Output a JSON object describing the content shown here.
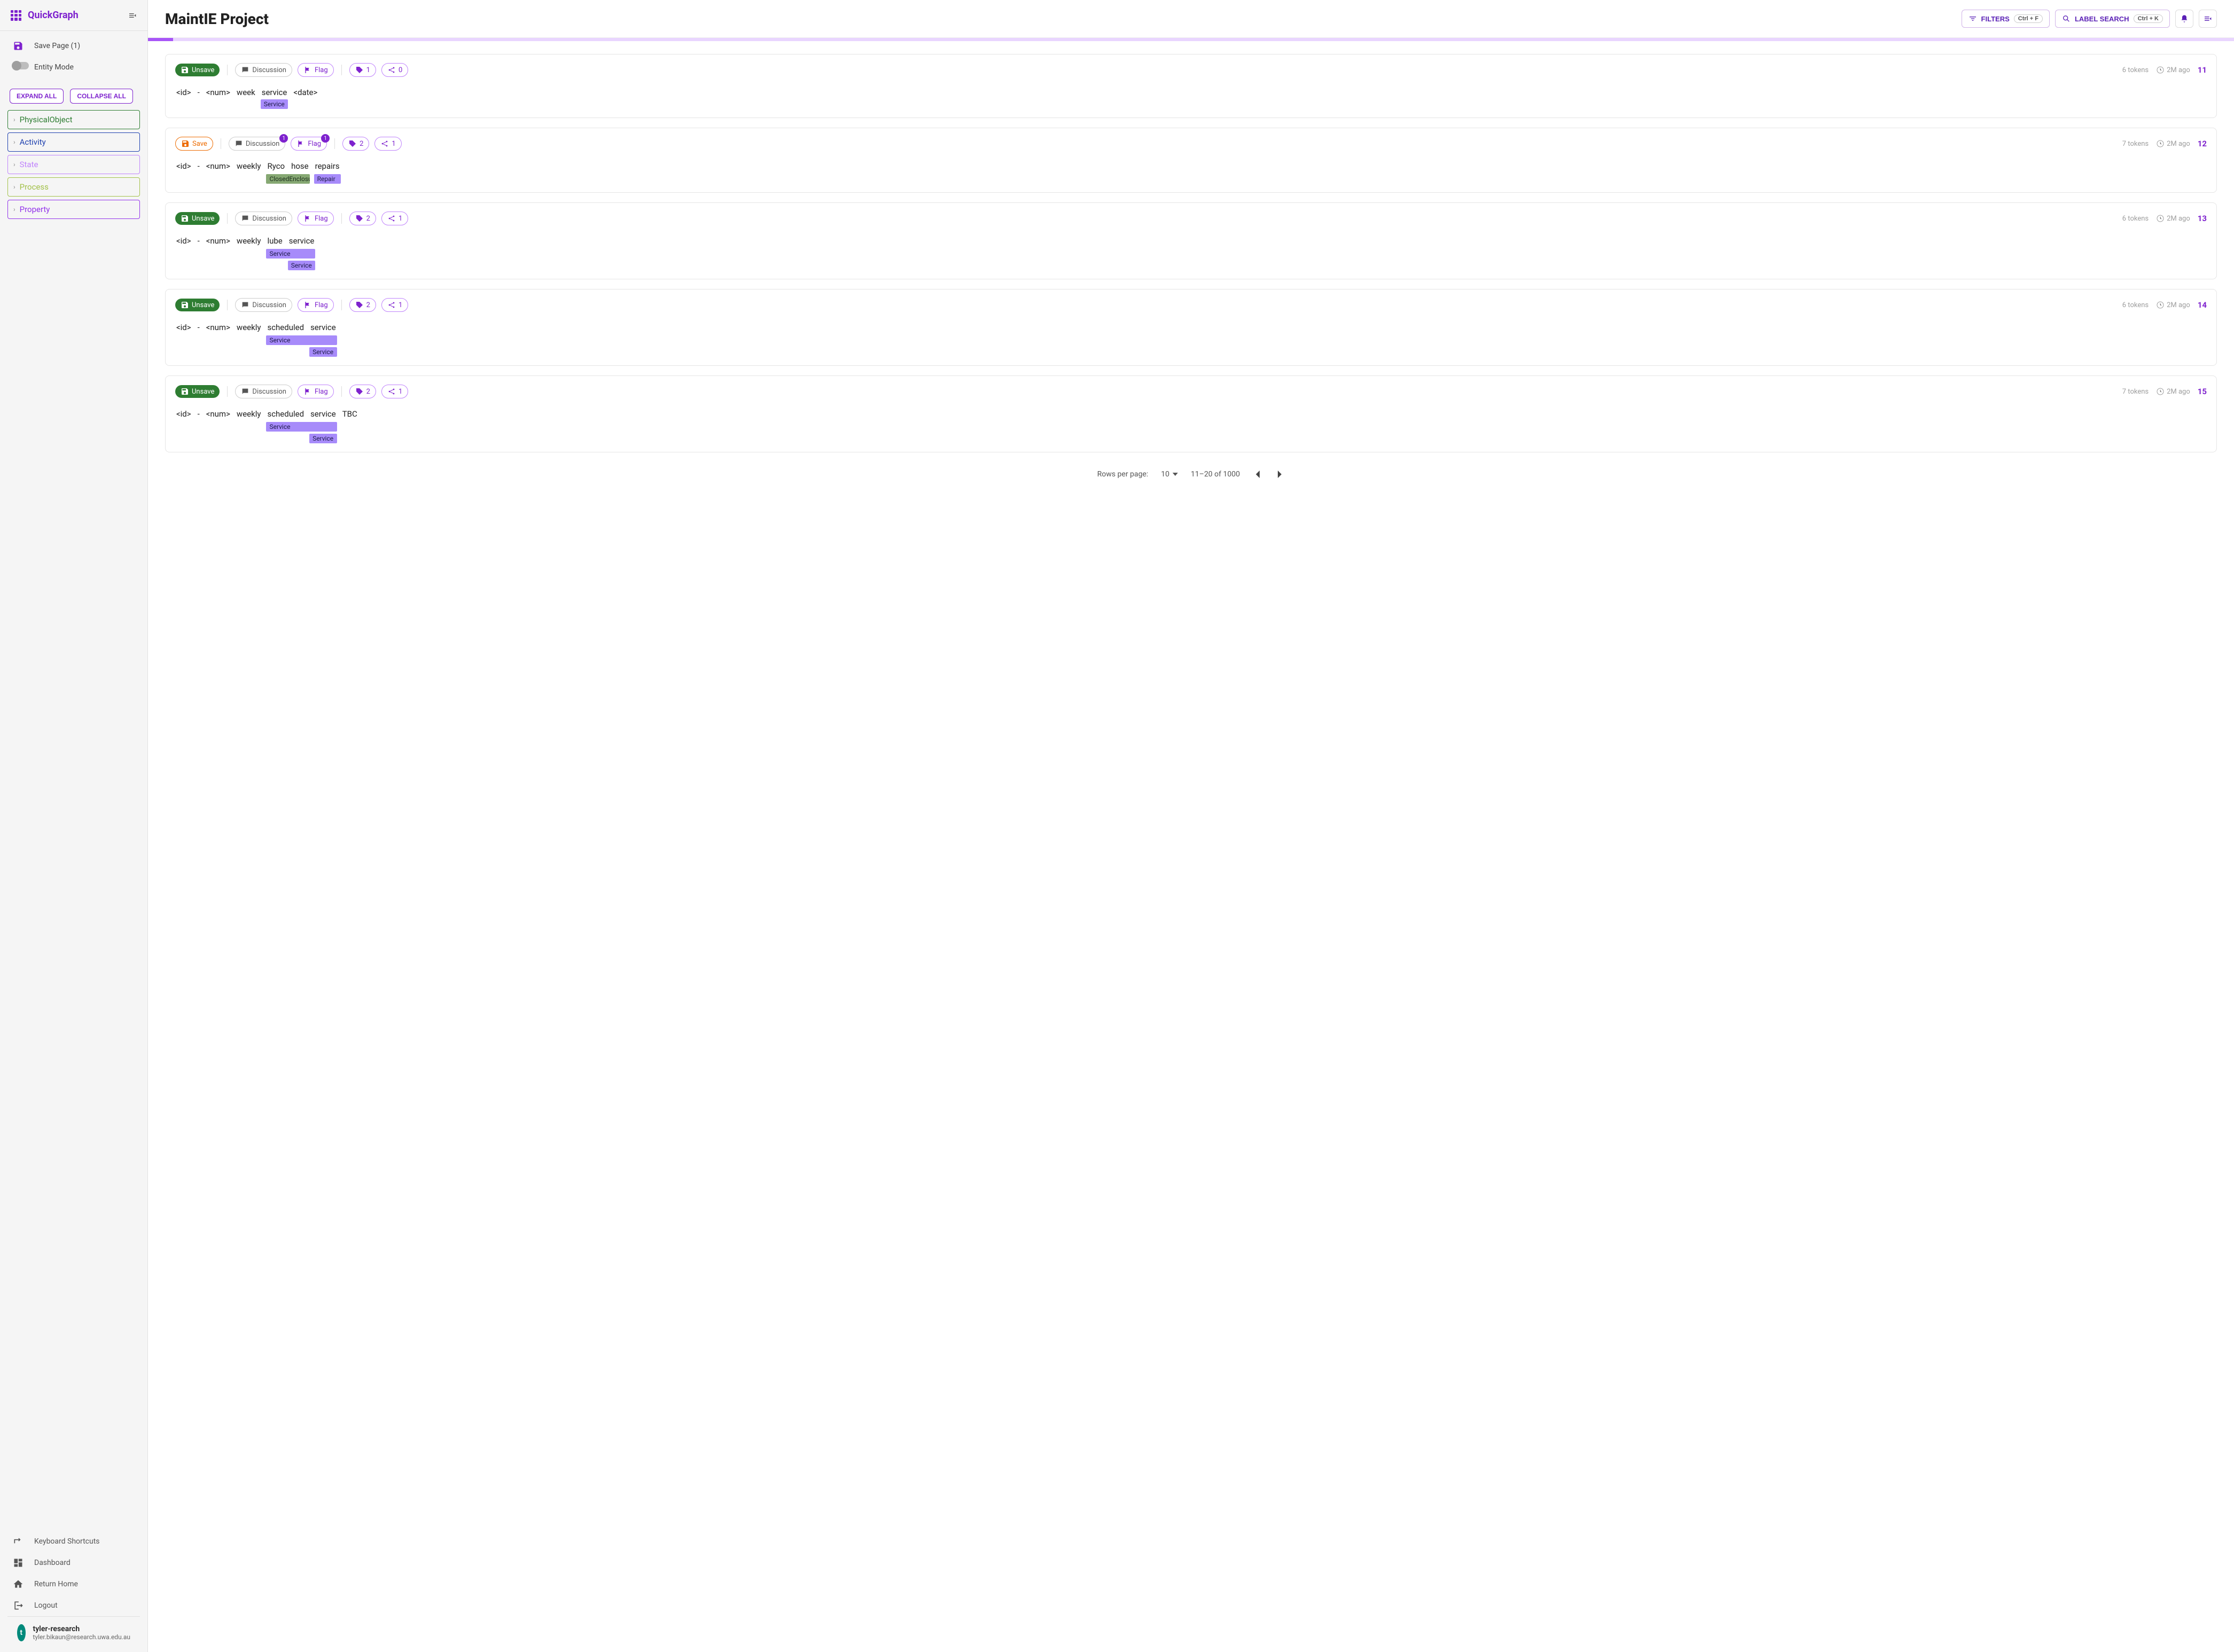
{
  "app": {
    "name": "QuickGraph"
  },
  "sidebar": {
    "save_page": "Save Page (1)",
    "entity_mode": "Entity Mode",
    "expand_all": "EXPAND ALL",
    "collapse_all": "COLLAPSE ALL",
    "categories": [
      {
        "label": "PhysicalObject"
      },
      {
        "label": "Activity"
      },
      {
        "label": "State"
      },
      {
        "label": "Process"
      },
      {
        "label": "Property"
      }
    ],
    "footer": {
      "shortcuts": "Keyboard Shortcuts",
      "dashboard": "Dashboard",
      "home": "Return Home",
      "logout": "Logout"
    },
    "user": {
      "initial": "t",
      "name": "tyler-research",
      "email": "tyler.bikaun@research.uwa.edu.au"
    }
  },
  "header": {
    "title": "MaintIE Project",
    "filters": "FILTERS",
    "filters_kbd": "Ctrl + F",
    "label_search": "LABEL SEARCH",
    "label_search_kbd": "Ctrl + K"
  },
  "cards": [
    {
      "save_state": "Unsave",
      "save_class": "pill-unsave",
      "discussion": "Discussion",
      "disc_badge": null,
      "flag": "Flag",
      "flag_badge": null,
      "count1": "1",
      "count2": "0",
      "tokens_meta": "6 tokens",
      "time": "2M ago",
      "idx": "11",
      "tokens": [
        "<id>",
        "-",
        "<num>",
        "week",
        "service",
        "<date>"
      ],
      "labels": {
        "4": [
          {
            "text": "Service",
            "cls": "lbl-service"
          }
        ]
      }
    },
    {
      "save_state": "Save",
      "save_class": "pill-save",
      "discussion": "Discussion",
      "disc_badge": "1",
      "flag": "Flag",
      "flag_badge": "1",
      "count1": "2",
      "count2": "1",
      "tokens_meta": "7 tokens",
      "time": "2M ago",
      "idx": "12",
      "tokens": [
        "<id>",
        "-",
        "<num>",
        "weekly",
        "Ryco",
        "hose",
        "repairs"
      ],
      "span_labels": [
        {
          "start": 4,
          "end": 5,
          "text": "ClosedEnclosureGuidingObject",
          "cls": "lbl-closed"
        },
        {
          "start": 6,
          "end": 6,
          "text": "Repair",
          "cls": "lbl-repair"
        }
      ]
    },
    {
      "save_state": "Unsave",
      "save_class": "pill-unsave",
      "discussion": "Discussion",
      "disc_badge": null,
      "flag": "Flag",
      "flag_badge": null,
      "count1": "2",
      "count2": "1",
      "tokens_meta": "6 tokens",
      "time": "2M ago",
      "idx": "13",
      "tokens": [
        "<id>",
        "-",
        "<num>",
        "weekly",
        "lube",
        "service"
      ],
      "span_labels": [
        {
          "start": 4,
          "end": 5,
          "text": "Service",
          "cls": "lbl-service",
          "row": 0
        },
        {
          "start": 5,
          "end": 5,
          "text": "Service",
          "cls": "lbl-service",
          "row": 1
        }
      ]
    },
    {
      "save_state": "Unsave",
      "save_class": "pill-unsave",
      "discussion": "Discussion",
      "disc_badge": null,
      "flag": "Flag",
      "flag_badge": null,
      "count1": "2",
      "count2": "1",
      "tokens_meta": "6 tokens",
      "time": "2M ago",
      "idx": "14",
      "tokens": [
        "<id>",
        "-",
        "<num>",
        "weekly",
        "scheduled",
        "service"
      ],
      "span_labels": [
        {
          "start": 4,
          "end": 5,
          "text": "Service",
          "cls": "lbl-service",
          "row": 0
        },
        {
          "start": 5,
          "end": 5,
          "text": "Service",
          "cls": "lbl-service",
          "row": 1
        }
      ]
    },
    {
      "save_state": "Unsave",
      "save_class": "pill-unsave",
      "discussion": "Discussion",
      "disc_badge": null,
      "flag": "Flag",
      "flag_badge": null,
      "count1": "2",
      "count2": "1",
      "tokens_meta": "7 tokens",
      "time": "2M ago",
      "idx": "15",
      "tokens": [
        "<id>",
        "-",
        "<num>",
        "weekly",
        "scheduled",
        "service",
        "TBC"
      ],
      "span_labels": [
        {
          "start": 4,
          "end": 5,
          "text": "Service",
          "cls": "lbl-service",
          "row": 0
        },
        {
          "start": 5,
          "end": 5,
          "text": "Service",
          "cls": "lbl-service",
          "row": 1
        }
      ]
    }
  ],
  "pagination": {
    "rpp_label": "Rows per page:",
    "rpp_value": "10",
    "range": "11–20 of 1000"
  }
}
